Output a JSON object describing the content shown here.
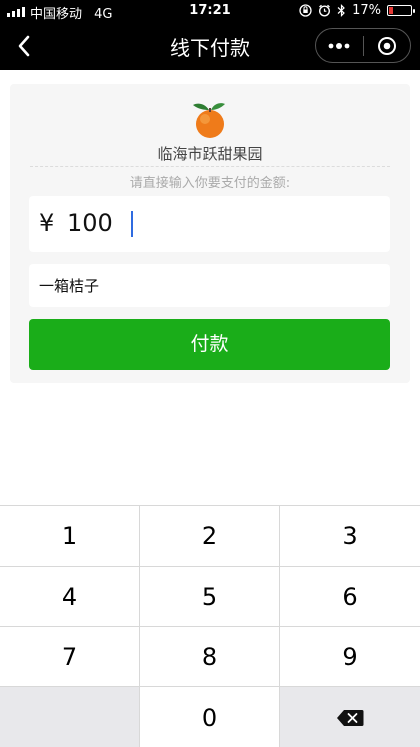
{
  "status_bar": {
    "carrier": "中国移动",
    "network": "4G",
    "time": "17:21",
    "battery": "17%",
    "battery_level": 0.17,
    "icons": [
      "signal-icon",
      "orientation-lock-icon",
      "alarm-icon",
      "bluetooth-icon",
      "battery-icon"
    ]
  },
  "nav": {
    "title": "线下付款",
    "back_icon": "chevron-left-icon",
    "capsule_icons": [
      "more-dots-icon",
      "close-circle-icon"
    ]
  },
  "merchant": {
    "logo_icon": "orange-fruit-icon",
    "name": "临海市跃甜果园"
  },
  "payment": {
    "hint": "请直接输入你要支付的金额:",
    "currency": "¥",
    "amount": "100",
    "remark": "一箱桔子",
    "pay_label": "付款"
  },
  "keypad": {
    "keys": [
      "1",
      "2",
      "3",
      "4",
      "5",
      "6",
      "7",
      "8",
      "9",
      "",
      "0",
      "backspace"
    ],
    "backspace_icon": "backspace-icon"
  },
  "colors": {
    "pay_button": "#1aad19",
    "caret": "#2f6be0",
    "nav_background": "#000000"
  }
}
